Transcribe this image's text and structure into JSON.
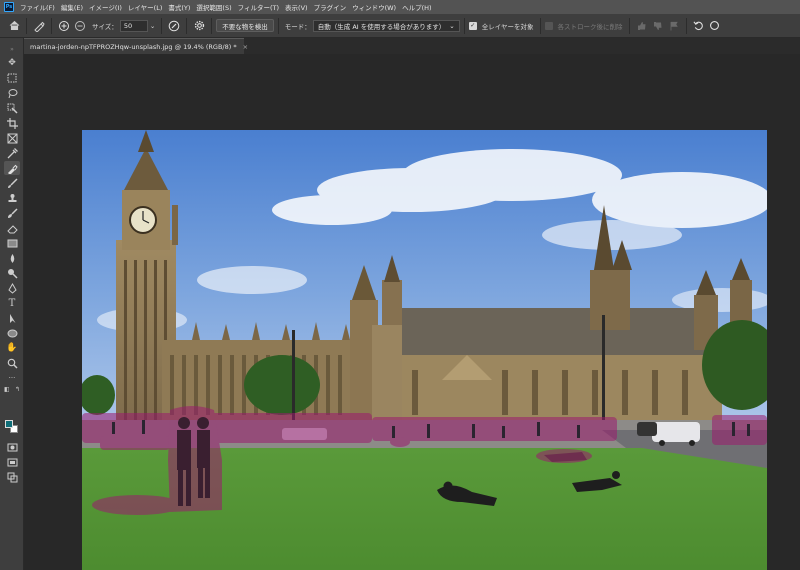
{
  "app": {
    "logo_text": "Ps"
  },
  "menu": [
    {
      "label": "ファイル(F)"
    },
    {
      "label": "編集(E)"
    },
    {
      "label": "イメージ(I)"
    },
    {
      "label": "レイヤー(L)"
    },
    {
      "label": "書式(Y)"
    },
    {
      "label": "選択範囲(S)"
    },
    {
      "label": "フィルター(T)"
    },
    {
      "label": "表示(V)"
    },
    {
      "label": "プラグイン"
    },
    {
      "label": "ウィンドウ(W)"
    },
    {
      "label": "ヘルプ(H)"
    }
  ],
  "options": {
    "size_label": "サイズ：",
    "size_value": "50",
    "find_distractions_label": "不要な物を検出",
    "mode_label": "モード：",
    "mode_value": "自動（生成 AI を使用する場合があります）",
    "sample_all_layers_label": "全レイヤーを対象",
    "apply_after_each_stroke_label": "各ストローク後に削除"
  },
  "document": {
    "tab_title": "martina-jorden-npTFPROZHqw-unsplash.jpg @ 19.4% (RGB/8) *"
  },
  "colors": {
    "foreground": "#0f6e78",
    "background": "#ffffff",
    "selection_overlay": "#9b1b6e"
  },
  "icons": {
    "home": "home-icon",
    "brush_tool": "remove-tool-icon",
    "add": "add-circle-icon",
    "subtract": "subtract-circle-icon",
    "settings": "gear-icon",
    "undo": "undo-icon",
    "circle": "circle-icon"
  }
}
